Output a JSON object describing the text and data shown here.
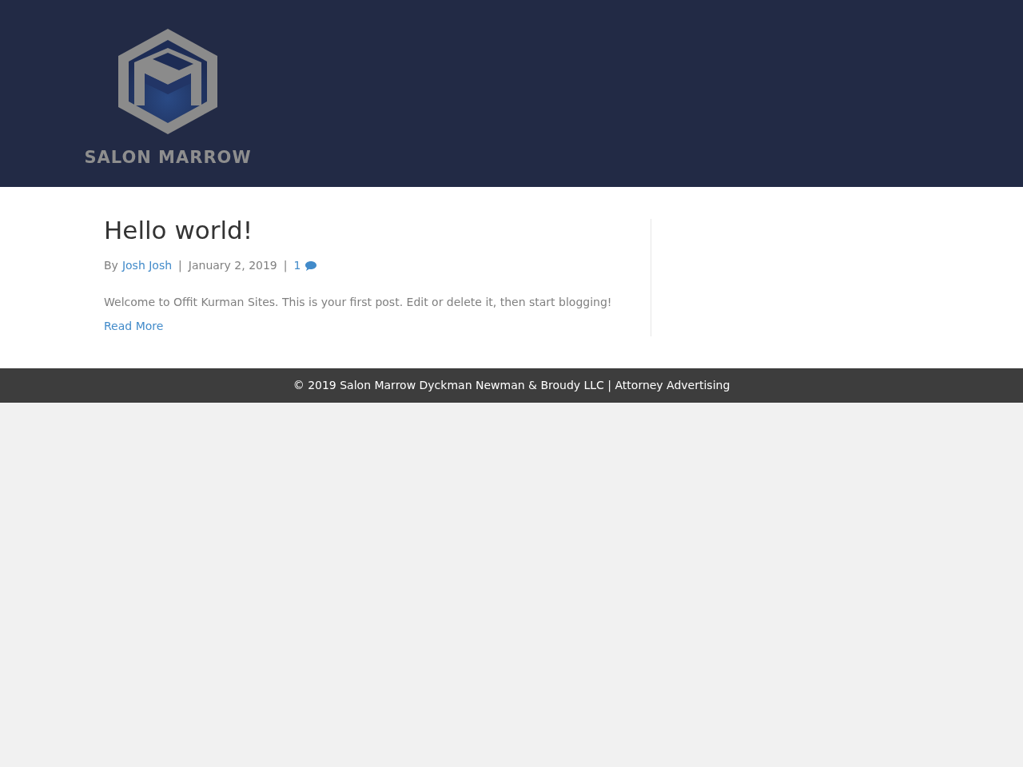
{
  "header": {
    "logo_text": "SALON MARROW"
  },
  "post": {
    "title": "Hello world!",
    "by": "By",
    "author": "Josh Josh",
    "separator_1": "|",
    "date": "January 2, 2019",
    "separator_2": "|",
    "comments": "1",
    "excerpt": "Welcome to Offit Kurman Sites. This is your first post. Edit or delete it, then start blogging!",
    "read_more": "Read More"
  },
  "footer": {
    "text": "© 2019 Salon Marrow Dyckman Newman & Broudy LLC | Attorney Advertising"
  }
}
